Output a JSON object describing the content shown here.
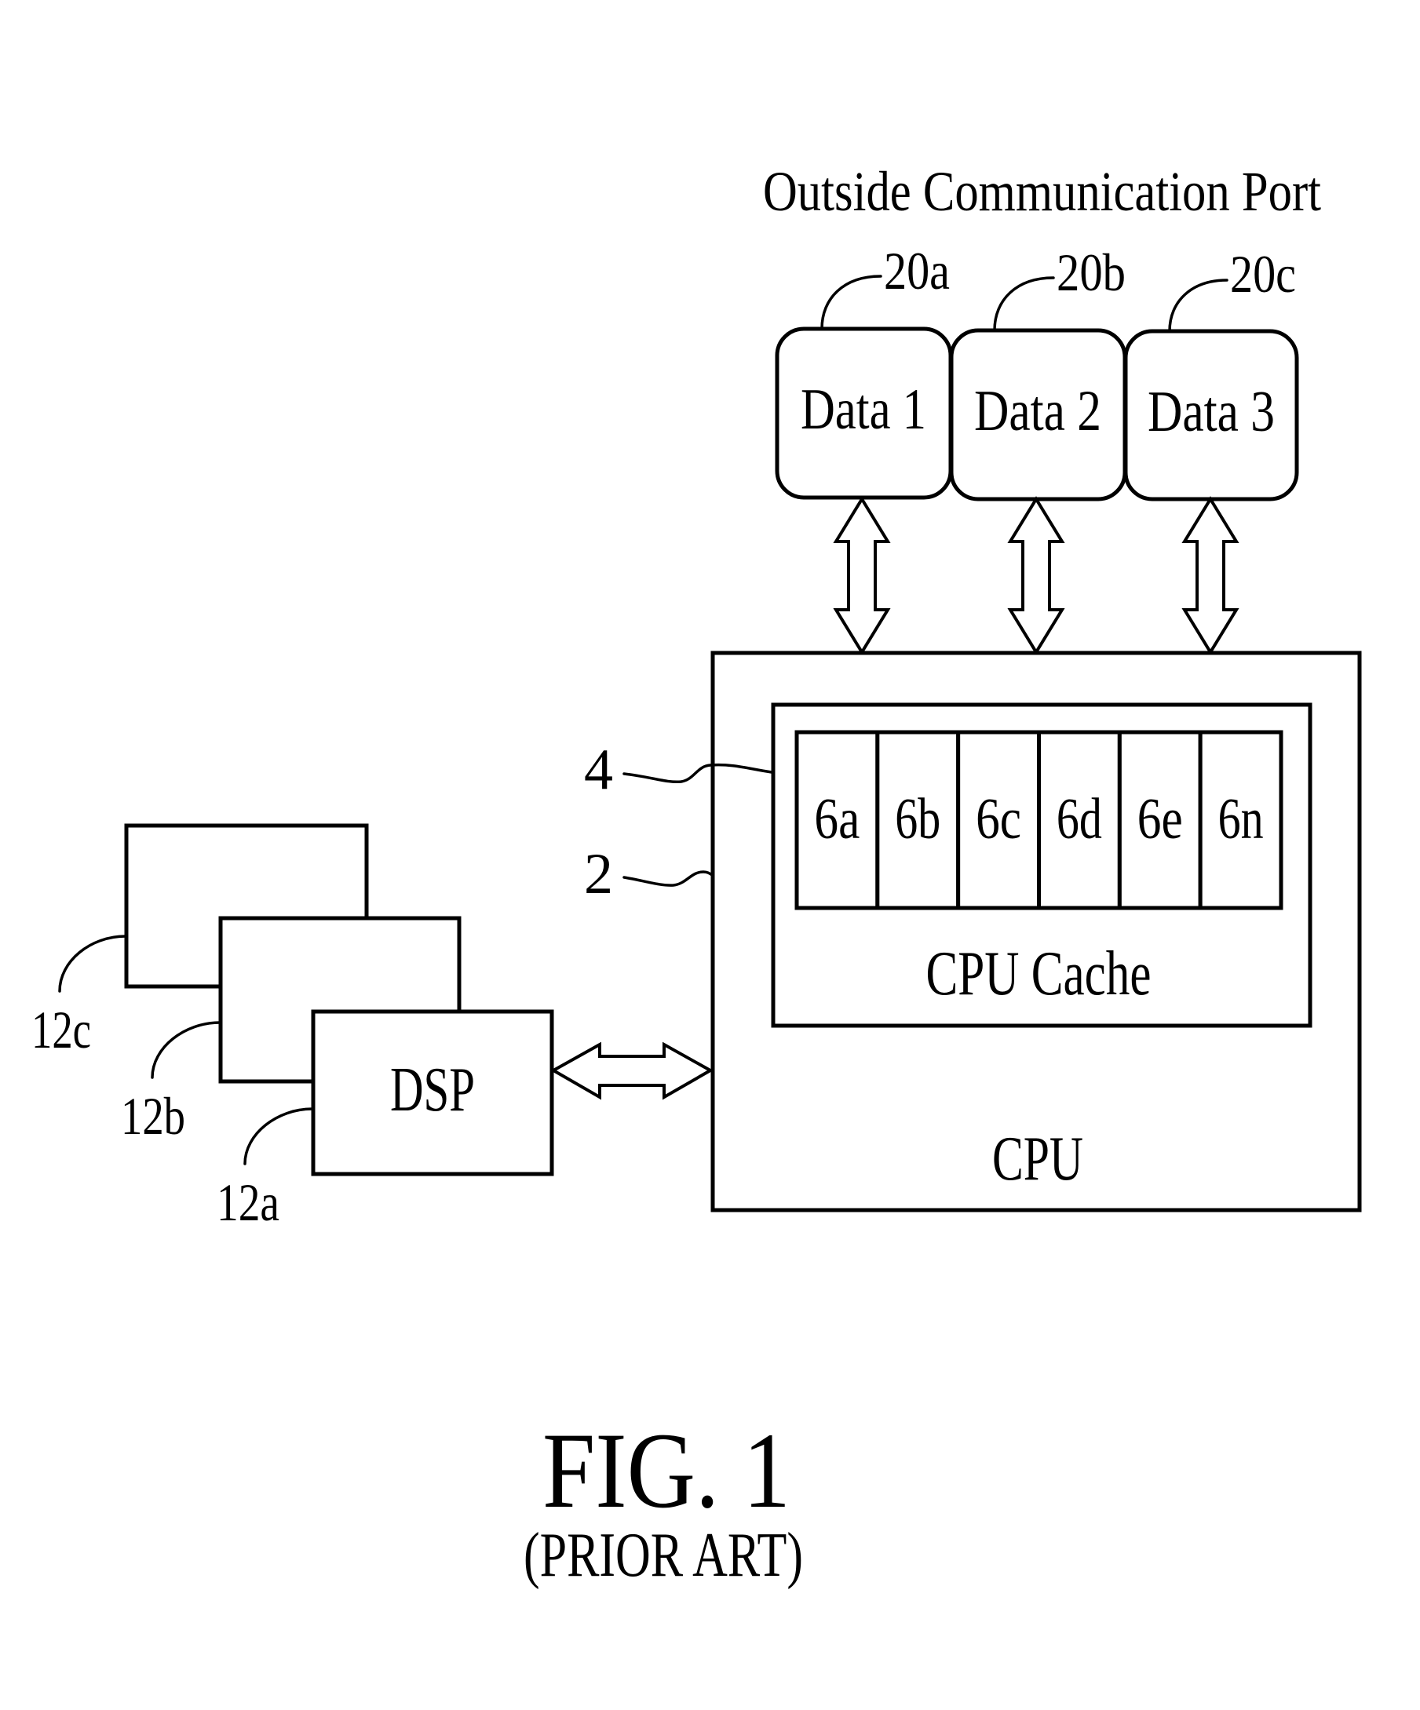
{
  "figure": {
    "title": "FIG. 1",
    "subtitle": "(PRIOR ART)"
  },
  "outside_port": {
    "heading": "Outside Communication Port",
    "data_blocks": [
      {
        "ref": "20a",
        "label": "Data 1"
      },
      {
        "ref": "20b",
        "label": "Data 2"
      },
      {
        "ref": "20c",
        "label": "Data 3"
      }
    ]
  },
  "cpu": {
    "ref": "2",
    "label": "CPU",
    "cache": {
      "ref": "4",
      "label": "CPU Cache",
      "lines": [
        "6a",
        "6b",
        "6c",
        "6d",
        "6e",
        "6n"
      ]
    }
  },
  "dsps": [
    {
      "ref": "12a",
      "label": "DSP"
    },
    {
      "ref": "12b",
      "label": ""
    },
    {
      "ref": "12c",
      "label": ""
    }
  ],
  "connections": [
    {
      "from": "Data 1",
      "to": "CPU",
      "type": "bidirectional"
    },
    {
      "from": "Data 2",
      "to": "CPU",
      "type": "bidirectional"
    },
    {
      "from": "Data 3",
      "to": "CPU",
      "type": "bidirectional"
    },
    {
      "from": "DSP",
      "to": "CPU",
      "type": "bidirectional"
    }
  ]
}
